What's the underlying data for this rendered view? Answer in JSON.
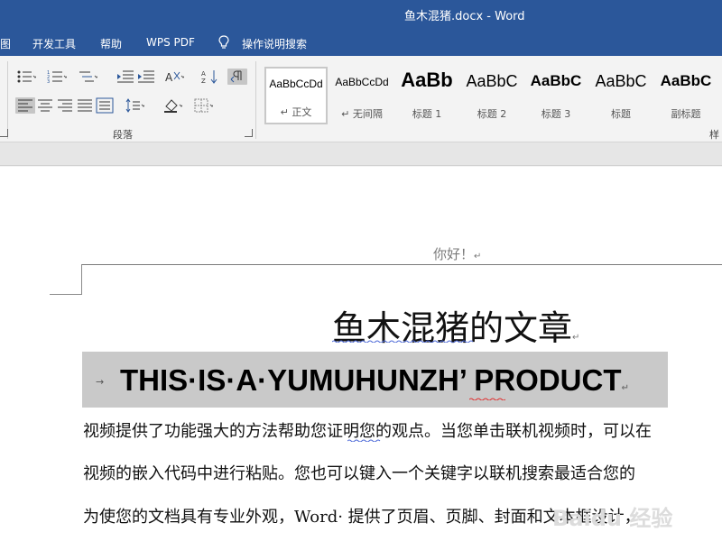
{
  "window": {
    "title": "鱼木混猪.docx  -  Word"
  },
  "menu": {
    "tabs": [
      {
        "label": "图"
      },
      {
        "label": "开发工具"
      },
      {
        "label": "帮助"
      },
      {
        "label": "WPS PDF"
      },
      {
        "label": "操作说明搜索"
      }
    ]
  },
  "ribbon": {
    "paragraph_group_label": "段落",
    "styles_group_label": "样",
    "styles": [
      {
        "sample": "AaBbCcDd",
        "name": "↵ 正文",
        "selected": true
      },
      {
        "sample": "AaBbCcDd",
        "name": "↵ 无间隔",
        "selected": false
      },
      {
        "sample": "AaBb",
        "name": "标题 1",
        "selected": false
      },
      {
        "sample": "AaBbC",
        "name": "标题 2",
        "selected": false
      },
      {
        "sample": "AaBbC",
        "name": "标题 3",
        "selected": false
      },
      {
        "sample": "AaBbC",
        "name": "标题",
        "selected": false
      },
      {
        "sample": "AaBbC",
        "name": "副标题",
        "selected": false
      }
    ]
  },
  "document": {
    "header_text": "你好！",
    "title": "鱼木混猪的文章",
    "heading": "THIS·IS·A·YUMUHUNZH’ PRODUCT",
    "body_lines": [
      "视频提供了功能强大的方法帮助您证明您的观点。当您单击联机视频时，可以在",
      "视频的嵌入代码中进行粘贴。您也可以键入一个关键字以联机搜索最适合您的",
      "为使您的文档具有专业外观，Word· 提供了页眉、页脚、封面和文本框设计，"
    ],
    "paragraph_mark": "↵",
    "heading_arrow": "→"
  },
  "watermark": {
    "text": "Baidu 经验"
  },
  "colors": {
    "accent": "#2b579a",
    "heading_band": "#c9c9c9",
    "squiggle_blue": "#4f6bd8",
    "squiggle_red": "#e03030"
  }
}
